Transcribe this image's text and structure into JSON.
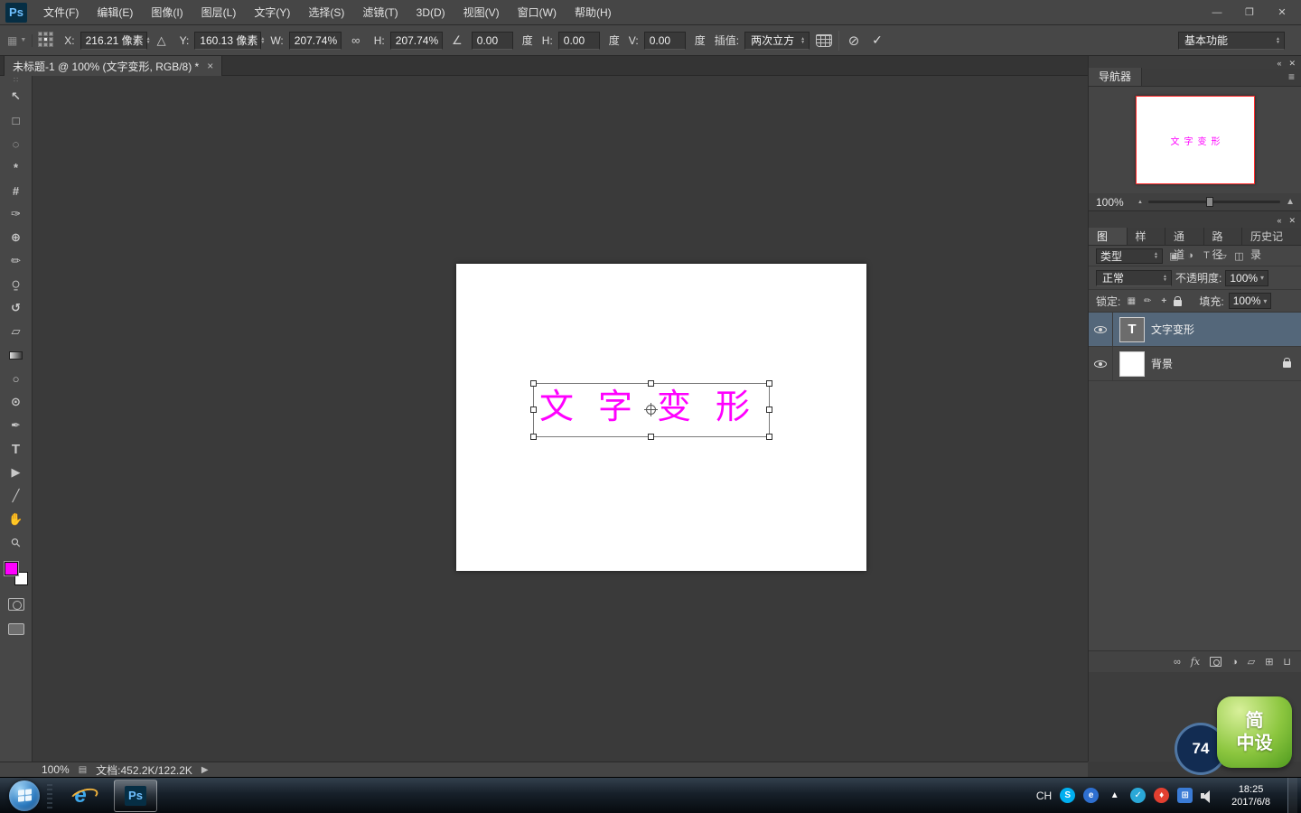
{
  "app": {
    "logo": "Ps"
  },
  "icons": {
    "up": "▲",
    "down": "▼",
    "collapse": "«",
    "close": "✕",
    "menu": "≡",
    "grid": "▦",
    "link": "∞",
    "rel": "△",
    "angle": "∠",
    "cancel": "⊘",
    "commit": "✓",
    "chevron": "▾",
    "page": "▤",
    "expand": "▶",
    "grip": "∷"
  },
  "menubar": {
    "items": [
      "文件(F)",
      "编辑(E)",
      "图像(I)",
      "图层(L)",
      "文字(Y)",
      "选择(S)",
      "滤镜(T)",
      "3D(D)",
      "视图(V)",
      "窗口(W)",
      "帮助(H)"
    ]
  },
  "window": {
    "minimize": "—",
    "maximize": "❐",
    "close": "✕"
  },
  "options": {
    "x_label": "X:",
    "x_value": "216.21 像素",
    "y_label": "Y:",
    "y_value": "160.13 像素",
    "w_label": "W:",
    "w_value": "207.74%",
    "h_label": "H:",
    "h_value": "207.74%",
    "angle_value": "0.00",
    "deg1": "度",
    "hskew_label": "H:",
    "hskew_value": "0.00",
    "deg2": "度",
    "vskew_label": "V:",
    "vskew_value": "0.00",
    "deg3": "度",
    "interp_label": "插值:",
    "interp_value": "两次立方",
    "workspace": "基本功能"
  },
  "document": {
    "tab": "未标题-1 @ 100% (文字变形, RGB/8) *",
    "close": "×"
  },
  "toolbar": {
    "tools": [
      {
        "name": "move-tool",
        "g": "↖"
      },
      {
        "name": "marquee-tool",
        "g": "□"
      },
      {
        "name": "lasso-tool",
        "g": "◌"
      },
      {
        "name": "quick-selection-tool",
        "g": "*"
      },
      {
        "name": "crop-tool",
        "g": "#"
      },
      {
        "name": "eyedropper-tool",
        "g": "✑"
      },
      {
        "name": "healing-brush-tool",
        "g": "⊕"
      },
      {
        "name": "brush-tool",
        "g": "✏"
      },
      {
        "name": "clone-stamp-tool",
        "g": "⍜"
      },
      {
        "name": "history-brush-tool",
        "g": "↺"
      },
      {
        "name": "eraser-tool",
        "g": "▱"
      },
      {
        "name": "gradient-tool",
        "g": "",
        "cls": "tool-grad"
      },
      {
        "name": "blur-tool",
        "g": "○"
      },
      {
        "name": "dodge-tool",
        "g": "⊙"
      },
      {
        "name": "pen-tool",
        "g": "✒"
      },
      {
        "name": "type-tool",
        "g": "T",
        "cls": "tool-T"
      },
      {
        "name": "path-selection-tool",
        "g": "▶"
      },
      {
        "name": "line-tool",
        "g": "╱"
      },
      {
        "name": "hand-tool",
        "g": "✋"
      },
      {
        "name": "zoom-tool",
        "g": "⚲",
        "cls": "tool-zoom"
      }
    ]
  },
  "canvas": {
    "text": "文字变形"
  },
  "navigator": {
    "title": "导航器",
    "zoom": "100%"
  },
  "panel_group": {
    "tabs": [
      {
        "label": "图层",
        "name": "tab-layers",
        "active": true
      },
      {
        "label": "样式",
        "name": "tab-styles"
      },
      {
        "label": "通道",
        "name": "tab-channels"
      },
      {
        "label": "路径",
        "name": "tab-paths"
      },
      {
        "label": "历史记录",
        "name": "tab-history"
      }
    ]
  },
  "layers": {
    "kind_label": "类型",
    "filter_icons": [
      {
        "name": "filter-pixel-layers-icon",
        "g": "▣"
      },
      {
        "name": "filter-adjustment-layers-icon",
        "g": "◑"
      },
      {
        "name": "filter-type-layers-icon",
        "g": "T"
      },
      {
        "name": "filter-shape-layers-icon",
        "g": "▱"
      },
      {
        "name": "filter-smart-objects-icon",
        "g": "◫"
      }
    ],
    "blend": "正常",
    "opacity_label": "不透明度:",
    "opacity": "100%",
    "lock_label": "锁定:",
    "lock_icons": [
      {
        "name": "lock-transparency-icon",
        "g": "▦"
      },
      {
        "name": "lock-pixels-icon",
        "g": "✏"
      },
      {
        "name": "lock-position-icon",
        "g": "+"
      },
      {
        "name": "lock-all-icon",
        "g": "",
        "cls": "lockico"
      }
    ],
    "fill_label": "填充:",
    "fill": "100%",
    "rows": [
      {
        "name": "文字变形",
        "thumb": "T"
      },
      {
        "name": "背景"
      }
    ],
    "bottom_icons": [
      {
        "name": "link-layers-icon",
        "g": "∞"
      },
      {
        "name": "layer-style-icon",
        "g": "fx",
        "cls": "fx"
      },
      {
        "name": "add-layer-mask-icon",
        "g": "",
        "cls": "mask-ico"
      },
      {
        "name": "adjustment-layer-icon",
        "g": "◑"
      },
      {
        "name": "new-group-icon",
        "g": "▱"
      },
      {
        "name": "new-layer-icon",
        "g": "⊞"
      },
      {
        "name": "delete-layer-icon",
        "g": "⊔"
      }
    ]
  },
  "status": {
    "zoom": "100%",
    "doc": "文档:452.2K/122.2K"
  },
  "taskbar": {
    "lang": "CH",
    "time": "18:25",
    "date": "2017/6/8",
    "icons": [
      {
        "name": "skype-tray-icon",
        "g": "S",
        "bg": "#00aff0",
        "cls": "tray-round"
      },
      {
        "name": "app-tray-icon",
        "g": "e",
        "bg": "#2e6fd0",
        "cls": "tray-round"
      },
      {
        "name": "show-hidden-icons",
        "g": "▲",
        "cls": "tray-txt"
      },
      {
        "name": "security-tray-icon",
        "g": "✓",
        "bg": "#2aa8d8",
        "cls": "tray-round"
      },
      {
        "name": "antivirus-tray-icon",
        "g": "♦",
        "bg": "#e23f30",
        "cls": "tray-round"
      },
      {
        "name": "manager-tray-icon",
        "g": "⊞",
        "bg": "#3a7bd5",
        "cls": "tray-sq"
      },
      {
        "name": "volume-icon",
        "g": "",
        "cls": "spk"
      }
    ]
  },
  "watermark": {
    "count": "74",
    "line1": "简",
    "line2": "中设"
  }
}
